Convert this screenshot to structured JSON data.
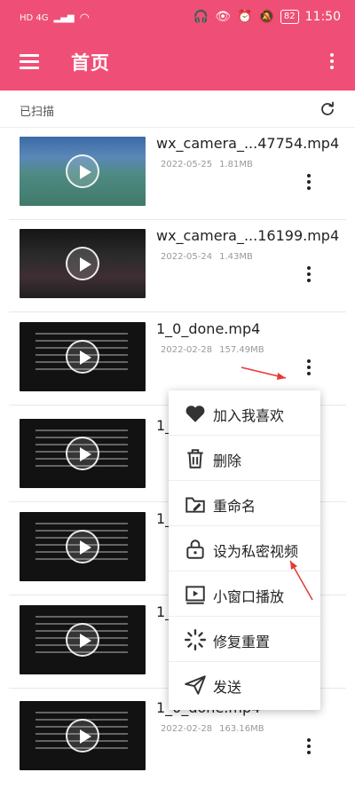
{
  "status_bar": {
    "network": "HD 4G",
    "battery": "82",
    "time": "11:50"
  },
  "app_bar": {
    "title": "首页"
  },
  "scanned": {
    "label": "已扫描"
  },
  "videos": [
    {
      "title": "wx_camera_...47754.mp4",
      "date": "2022-05-25",
      "size": "1.81MB",
      "thumb": "court"
    },
    {
      "title": "wx_camera_...16199.mp4",
      "date": "2022-05-24",
      "size": "1.43MB",
      "thumb": "night"
    },
    {
      "title": "1_0_done.mp4",
      "date": "2022-02-28",
      "size": "157.49MB",
      "thumb": "dark"
    },
    {
      "title": "1_",
      "date": "",
      "size": "",
      "thumb": "dark"
    },
    {
      "title": "1_",
      "date": "",
      "size": "",
      "thumb": "dark"
    },
    {
      "title": "1_",
      "date": "",
      "size": "",
      "thumb": "dark"
    },
    {
      "title": "1_0_done.mp4",
      "date": "2022-02-28",
      "size": "163.16MB",
      "thumb": "dark"
    }
  ],
  "menu": {
    "items": [
      {
        "label": "加入我喜欢",
        "icon": "heart-icon"
      },
      {
        "label": "删除",
        "icon": "trash-icon"
      },
      {
        "label": "重命名",
        "icon": "rename-icon"
      },
      {
        "label": "设为私密视频",
        "icon": "lock-icon"
      },
      {
        "label": "小窗口播放",
        "icon": "mini-window-icon"
      },
      {
        "label": "修复重置",
        "icon": "repair-icon"
      },
      {
        "label": "发送",
        "icon": "send-icon"
      }
    ]
  },
  "colors": {
    "accent": "#ef4f76",
    "annotation_arrow": "#e53935"
  }
}
